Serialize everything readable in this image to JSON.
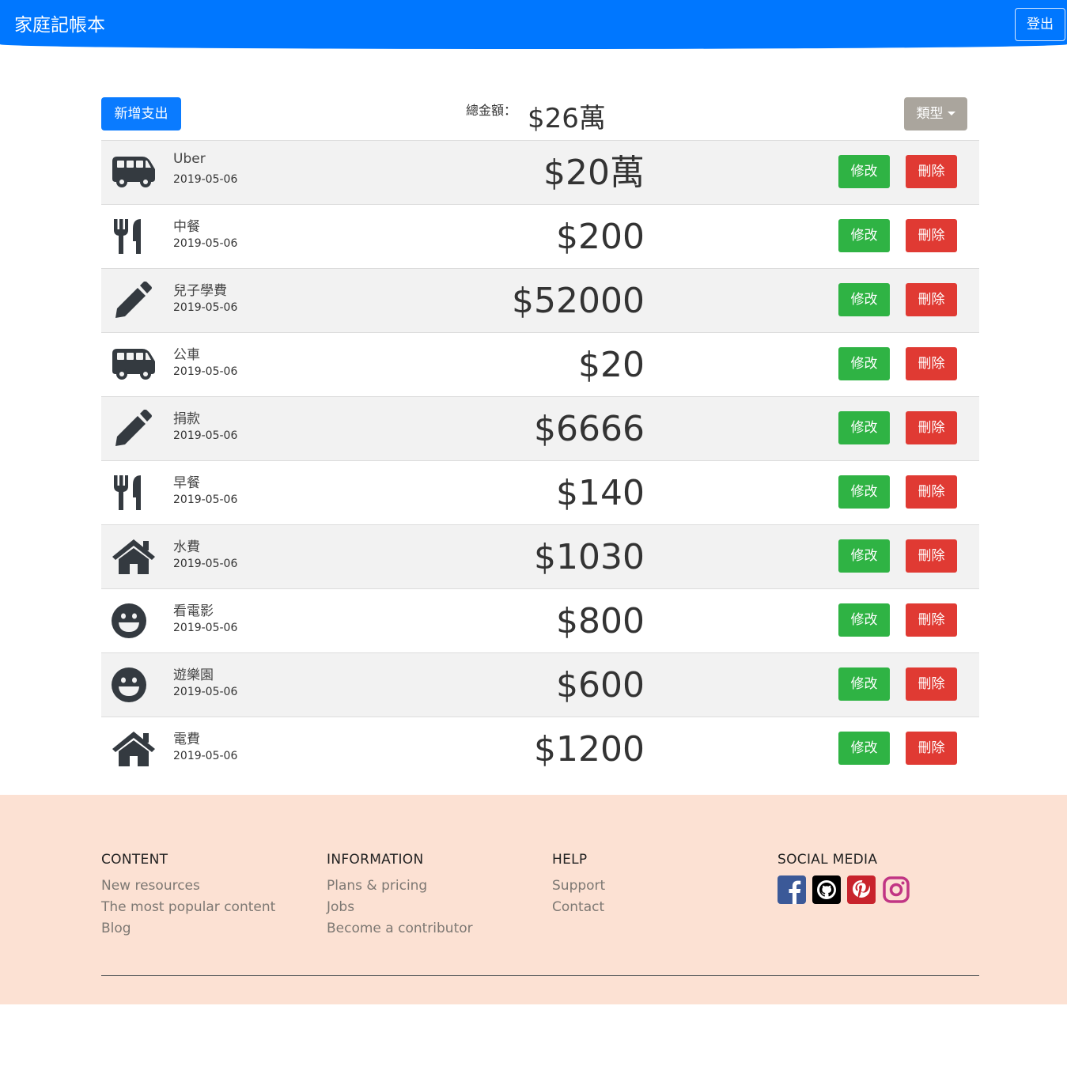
{
  "navbar": {
    "brand": "家庭記帳本",
    "logout": "登出"
  },
  "toolbar": {
    "add_label": "新增支出",
    "total_label": "總金額：",
    "total_value": "$26萬",
    "type_label": "類型"
  },
  "colors": {
    "navbar": "#0077ff",
    "add_button": "#0a7bff",
    "type_button": "#aaa59d",
    "edit_button": "#2fb344",
    "delete_button": "#e03a33",
    "footer": "#fce1d3"
  },
  "expenses": [
    {
      "icon": "bus-icon",
      "name": "Uber",
      "date": "2019-05-06",
      "amount": "$20萬",
      "edit": "修改",
      "delete": "刪除"
    },
    {
      "icon": "utensils-icon",
      "name": "中餐",
      "date": "2019-05-06",
      "amount": "$200",
      "edit": "修改",
      "delete": "刪除"
    },
    {
      "icon": "pencil-icon",
      "name": "兒子學費",
      "date": "2019-05-06",
      "amount": "$52000",
      "edit": "修改",
      "delete": "刪除"
    },
    {
      "icon": "bus-icon",
      "name": "公車",
      "date": "2019-05-06",
      "amount": "$20",
      "edit": "修改",
      "delete": "刪除"
    },
    {
      "icon": "pencil-icon",
      "name": "捐款",
      "date": "2019-05-06",
      "amount": "$6666",
      "edit": "修改",
      "delete": "刪除"
    },
    {
      "icon": "utensils-icon",
      "name": "早餐",
      "date": "2019-05-06",
      "amount": "$140",
      "edit": "修改",
      "delete": "刪除"
    },
    {
      "icon": "home-icon",
      "name": "水費",
      "date": "2019-05-06",
      "amount": "$1030",
      "edit": "修改",
      "delete": "刪除"
    },
    {
      "icon": "smile-icon",
      "name": "看電影",
      "date": "2019-05-06",
      "amount": "$800",
      "edit": "修改",
      "delete": "刪除"
    },
    {
      "icon": "smile-icon",
      "name": "遊樂園",
      "date": "2019-05-06",
      "amount": "$600",
      "edit": "修改",
      "delete": "刪除"
    },
    {
      "icon": "home-icon",
      "name": "電費",
      "date": "2019-05-06",
      "amount": "$1200",
      "edit": "修改",
      "delete": "刪除"
    }
  ],
  "footer": {
    "columns": [
      {
        "heading": "CONTENT",
        "links": [
          "New resources",
          "The most popular content",
          "Blog"
        ]
      },
      {
        "heading": "INFORMATION",
        "links": [
          "Plans & pricing",
          "Jobs",
          "Become a contributor"
        ]
      },
      {
        "heading": "HELP",
        "links": [
          "Support",
          "Contact"
        ]
      }
    ],
    "social_heading": "SOCIAL MEDIA",
    "social_icons": [
      "facebook-icon",
      "github-icon",
      "pinterest-icon",
      "instagram-icon"
    ]
  }
}
